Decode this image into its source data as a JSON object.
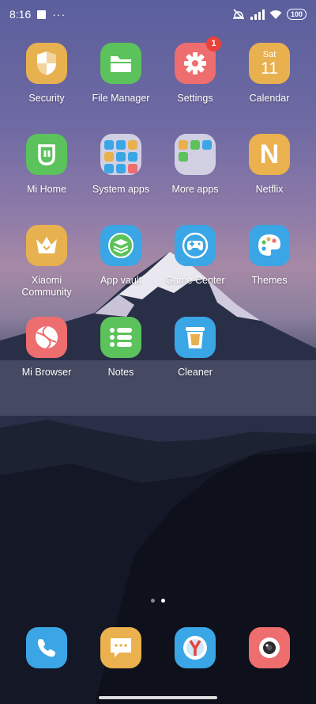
{
  "status_bar": {
    "time": "8:16",
    "more_indicator": "···",
    "battery": "100"
  },
  "apps": [
    {
      "label": "Security",
      "icon": "shield-icon",
      "color": "#e8b14f"
    },
    {
      "label": "File Manager",
      "icon": "folder-icon",
      "color": "#5cc25b"
    },
    {
      "label": "Settings",
      "icon": "gear-icon",
      "color": "#ee6d6f",
      "badge": "1"
    },
    {
      "label": "Calendar",
      "icon": "calendar-icon",
      "color": "#e9b04f",
      "day": "Sat",
      "date": "11"
    },
    {
      "label": "Mi Home",
      "icon": "mi-home-icon",
      "color": "#5cc25b"
    },
    {
      "label": "System apps",
      "icon": "folder-grid-icon"
    },
    {
      "label": "More apps",
      "icon": "folder-grid-icon"
    },
    {
      "label": "Netflix",
      "icon": "netflix-icon",
      "color": "#eab14e",
      "glyph": "N"
    },
    {
      "label": "Xiaomi\nCommunity",
      "icon": "crown-icon",
      "color": "#e8b14f"
    },
    {
      "label": "App vault",
      "icon": "layers-icon",
      "color": "#3aa6e6"
    },
    {
      "label": "Game Center",
      "icon": "gamepad-icon",
      "color": "#3aa6e6"
    },
    {
      "label": "Themes",
      "icon": "palette-icon",
      "color": "#3aa6e6"
    },
    {
      "label": "Mi Browser",
      "icon": "browser-icon",
      "color": "#ee6d6f"
    },
    {
      "label": "Notes",
      "icon": "list-icon",
      "color": "#5cc25b"
    },
    {
      "label": "Cleaner",
      "icon": "trash-icon",
      "color": "#3aa6e6"
    }
  ],
  "dock": [
    {
      "icon": "phone-icon",
      "color": "#3aa6e6"
    },
    {
      "icon": "message-icon",
      "color": "#eab14e"
    },
    {
      "icon": "yandex-browser-icon",
      "color": "#3aa6e6"
    },
    {
      "icon": "camera-icon",
      "color": "#ee6d6f"
    }
  ],
  "pager": {
    "pages": 2,
    "active": 2
  }
}
